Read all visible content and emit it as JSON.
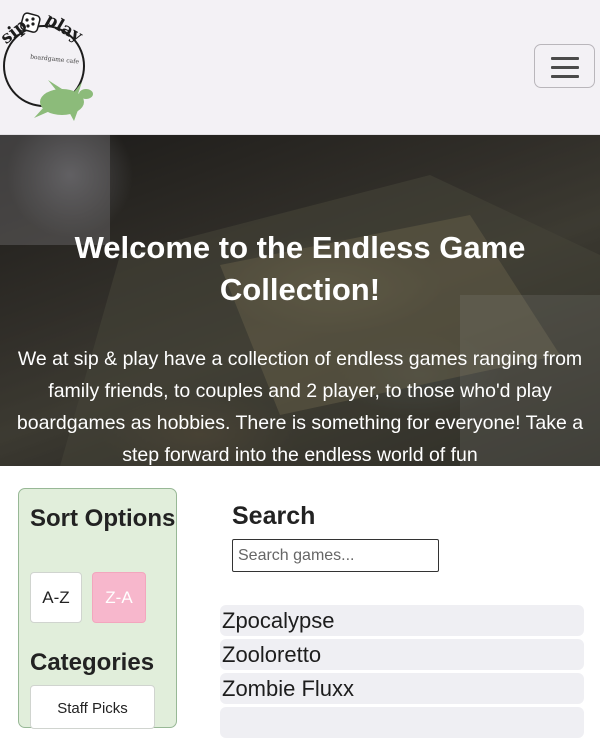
{
  "brand": {
    "logo_text_1": "sip",
    "logo_text_2": "play",
    "logo_sub": "boardgame cafe",
    "turtle_color": "#8cbb7a"
  },
  "nav": {
    "toggle_icon": "hamburger-menu-icon"
  },
  "hero": {
    "title": "Welcome to the Endless Game Collection!",
    "description": "We at sip & play have a collection of endless games ranging from family friends, to couples and 2 player, to those who'd play boardgames as hobbies. There is something for everyone! Take a step forward into the endless world of fun"
  },
  "sidebar": {
    "sort_title": "Sort Options",
    "sort_az": "A-Z",
    "sort_za": "Z-A",
    "categories_title": "Categories",
    "category_first": "Staff Picks",
    "panel_color": "#e1eedb",
    "active_sort_color": "#f7b7cc"
  },
  "search": {
    "heading": "Search",
    "placeholder": "Search games..."
  },
  "games": [
    "Zpocalypse",
    "Zooloretto",
    "Zombie Fluxx"
  ]
}
